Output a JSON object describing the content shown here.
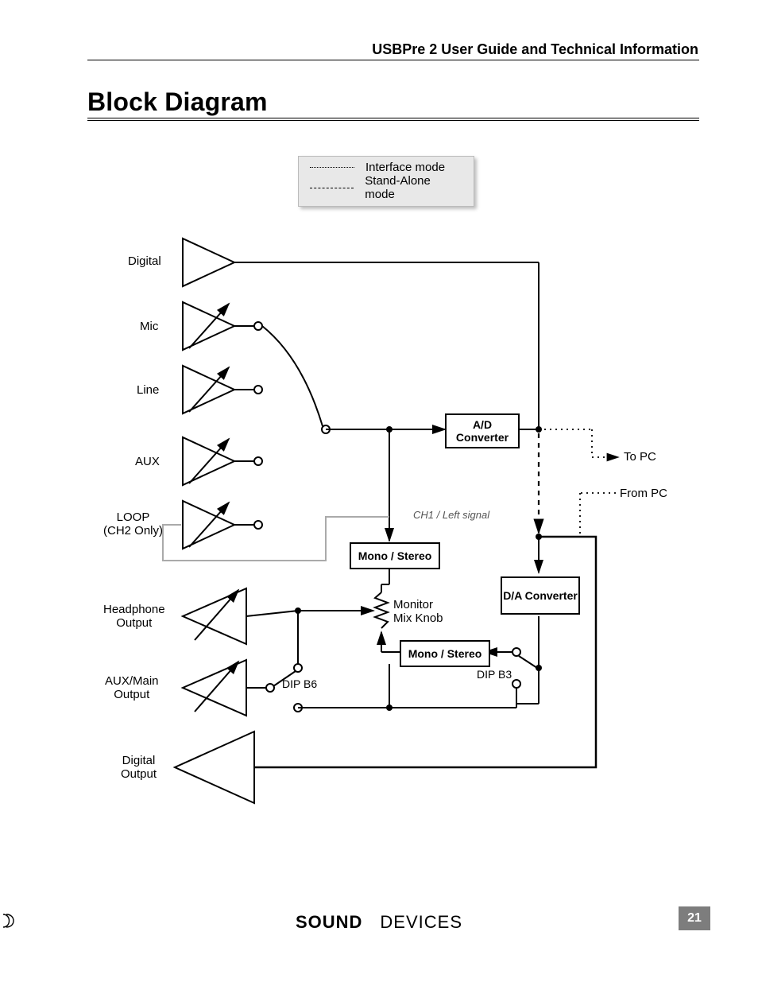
{
  "header": "USBPre 2 User Guide and Technical Information",
  "title": "Block Diagram",
  "page_number": "21",
  "footer_brand_bold": "SOUND",
  "footer_brand_light": "DEVICES",
  "legend": {
    "interface": "Interface mode",
    "standalone": "Stand-Alone mode"
  },
  "inputs": {
    "digital": "Digital",
    "mic": "Mic",
    "line": "Line",
    "aux": "AUX",
    "loop": "LOOP\n(CH2 Only)"
  },
  "outputs": {
    "headphone": "Headphone\nOutput",
    "auxmain": "AUX/Main\nOutput",
    "digital": "Digital\nOutput"
  },
  "blocks": {
    "ad": "A/D\nConverter",
    "da": "D/A\nConverter",
    "mono1": "Mono / Stereo",
    "mono2": "Mono / Stereo",
    "monitor": "Monitor\nMix Knob"
  },
  "notes": {
    "ch1": "CH1 / Left signal",
    "dip_b6": "DIP B6",
    "dip_b3": "DIP B3",
    "to_pc": "To PC",
    "from_pc": "From PC"
  }
}
